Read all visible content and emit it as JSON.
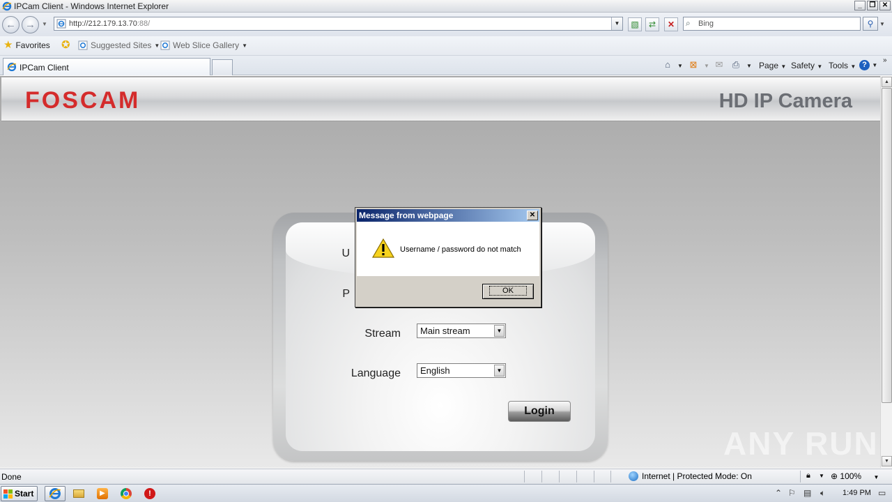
{
  "window": {
    "title": "IPCam Client - Windows Internet Explorer",
    "controls": [
      "minimize",
      "restore",
      "close"
    ]
  },
  "address_bar": {
    "url_host": "http://212.179.13.70",
    "url_port": ":88/",
    "search_placeholder": "Bing"
  },
  "favorites_bar": {
    "favorites_label": "Favorites",
    "suggested_sites_label": "Suggested Sites",
    "web_slice_gallery_label": "Web Slice Gallery"
  },
  "tab_bar": {
    "active_tab_label": "IPCam Client",
    "commands": {
      "page": "Page",
      "safety": "Safety",
      "tools": "Tools"
    }
  },
  "page": {
    "logo_text": "FOSCAM",
    "header_title": "HD IP Camera",
    "username_label_partial": "U",
    "password_label_partial": "P",
    "stream_label": "Stream",
    "stream_value": "Main stream",
    "language_label": "Language",
    "language_value": "English",
    "login_button": "Login"
  },
  "dialog": {
    "title": "Message from webpage",
    "message": "Username / password do not match",
    "ok_button": "OK",
    "icon": "warning-icon"
  },
  "status_bar": {
    "status": "Done",
    "zone": "Internet | Protected Mode: On",
    "zoom": "100%"
  },
  "taskbar": {
    "start_label": "Start",
    "time": "1:49 PM"
  },
  "watermark": "ANY RUN",
  "colors": {
    "foscam_red": "#d42b2b",
    "dialog_title_blue": "#0a246a",
    "header_grey": "#6b6e74"
  }
}
